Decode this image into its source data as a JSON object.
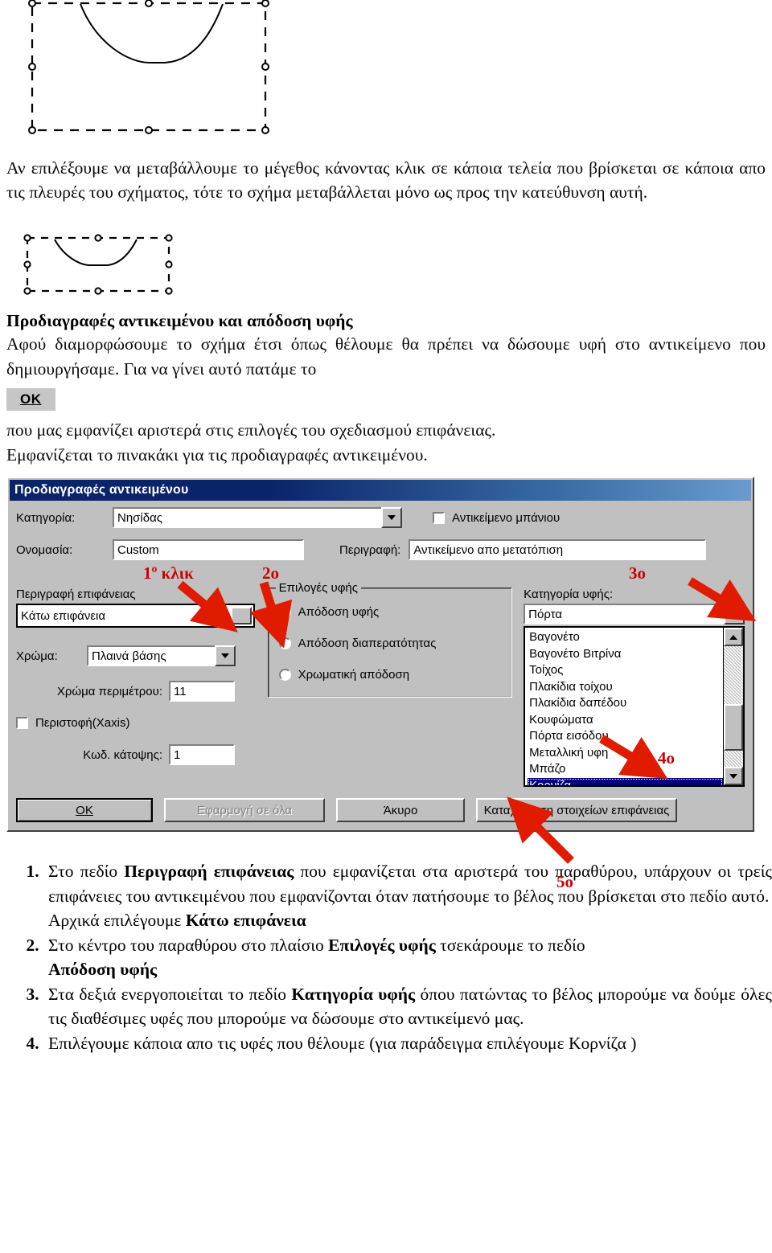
{
  "intro_paragraph": "Αν επιλέξουμε να μεταβάλλουμε το μέγεθος κάνοντας κλικ σε κάποια τελεία που βρίσκεται σε κάποια απο τις πλευρές του σχήματος, τότε το σχήμα μεταβάλλεται μόνο ως προς την κατεύθυνση αυτή.",
  "section": {
    "title": "Προδιαγραφές αντικειμένου και απόδοση υφής",
    "text_before_button": "Αφού διαμορφώσουμε το σχήμα έτσι όπως θέλουμε θα πρέπει να δώσουμε υφή στο αντικείμενο που δημιουργήσαμε. Για να γίνει αυτό πατάμε το",
    "inline_button_label": "OK",
    "text_after_button_line1": "που μας εμφανίζει αριστερά στις επιλογές του σχεδιασμού επιφάνειας.",
    "text_after_button_line2": "Εμφανίζεται το πινακάκι για τις προδιαγραφές αντικειμένου."
  },
  "dialog": {
    "title": "Προδιαγραφές αντικειμένου",
    "category_label": "Κατηγορία:",
    "category_value": "Νησίδας",
    "name_label": "Ονομασία:",
    "name_value": "Custom",
    "bath_object_checkbox_label": "Αντικείμενο μπάνιου",
    "description_label": "Περιγραφή:",
    "description_value": "Αντικείμενο απο μετατόπιση",
    "surface_description_label": "Περιγραφή επιφάνειας",
    "surface_description_value": "Κάτω επιφάνεια",
    "color_label": "Χρώμα:",
    "color_value": "Πλαινά βάσης",
    "perimeter_color_label": "Χρώμα περιμέτρου:",
    "perimeter_color_value": "11",
    "rotation_checkbox_label": "Περιστοφή(Xaxis)",
    "plan_code_label": "Κωδ. κάτοψης:",
    "plan_code_value": "1",
    "texture_options_legend": "Επιλογές υφής",
    "texture_options": [
      {
        "label": "Απόδοση υφής",
        "selected": true
      },
      {
        "label": "Απόδοση διαπερατότητας",
        "selected": false
      },
      {
        "label": "Χρωματική απόδοση",
        "selected": false
      }
    ],
    "texture_category_label": "Κατηγορία υφής:",
    "texture_category_value": "Πόρτα",
    "texture_list": [
      {
        "label": "Βαγονέτο",
        "selected": false
      },
      {
        "label": "Βαγονέτο Βιτρίνα",
        "selected": false
      },
      {
        "label": "Τοίχος",
        "selected": false
      },
      {
        "label": "Πλακίδια τοίχου",
        "selected": false
      },
      {
        "label": "Πλακίδια δαπέδου",
        "selected": false
      },
      {
        "label": "Κουφώματα",
        "selected": false
      },
      {
        "label": "Πόρτα εισόδου",
        "selected": false
      },
      {
        "label": "Μεταλλική υφη",
        "selected": false
      },
      {
        "label": "Μπάζο",
        "selected": false
      },
      {
        "label": "Κορνίζα",
        "selected": true
      }
    ],
    "buttons": {
      "ok": "OK",
      "apply_all": "Εφαρμογή σε όλα",
      "cancel": "Άκυρο",
      "register_surface": "Καταχώρηση στοιχείων επιφάνειας"
    }
  },
  "annotations": [
    {
      "id": "a1",
      "text": "1º κλικ"
    },
    {
      "id": "a2",
      "text": "2o"
    },
    {
      "id": "a3",
      "text": "3o"
    },
    {
      "id": "a4",
      "text": "4o"
    },
    {
      "id": "a5",
      "text": "5o"
    }
  ],
  "steps": {
    "item1_part1": "Στο πεδίο ",
    "item1_bold1": "Περιγραφή επιφάνειας",
    "item1_part2": " που εμφανίζεται στα αριστερά του παραθύρου, υπάρχουν οι τρείς επιφάνειες του αντικειμένου που εμφανίζονται όταν πατήσουμε το βέλος που βρίσκεται στο πεδίο αυτό.",
    "item1_sub_part1": "Αρχικά επιλέγουμε ",
    "item1_sub_bold": "Κάτω επιφάνεια",
    "item2_part1": "Στο κέντρο του παραθύρου στο πλαίσιο ",
    "item2_bold1": "Επιλογές υφής",
    "item2_part2": " τσεκάρουμε το πεδίο",
    "item2_bold2": "Απόδοση υφής",
    "item3_part1": "Στα δεξιά ενεργοποιείται το πεδίο ",
    "item3_bold1": "Κατηγορία υφής",
    "item3_part2": " όπου πατώντας το βέλος μπορούμε να δούμε όλες τις διαθέσιμες υφές που μπορούμε να δώσουμε στο αντικείμενό μας.",
    "item4_text": "Επιλέγουμε κάποια απο τις υφές που θέλουμε (για παράδειγμα επιλέγουμε Κορνίζα )"
  }
}
